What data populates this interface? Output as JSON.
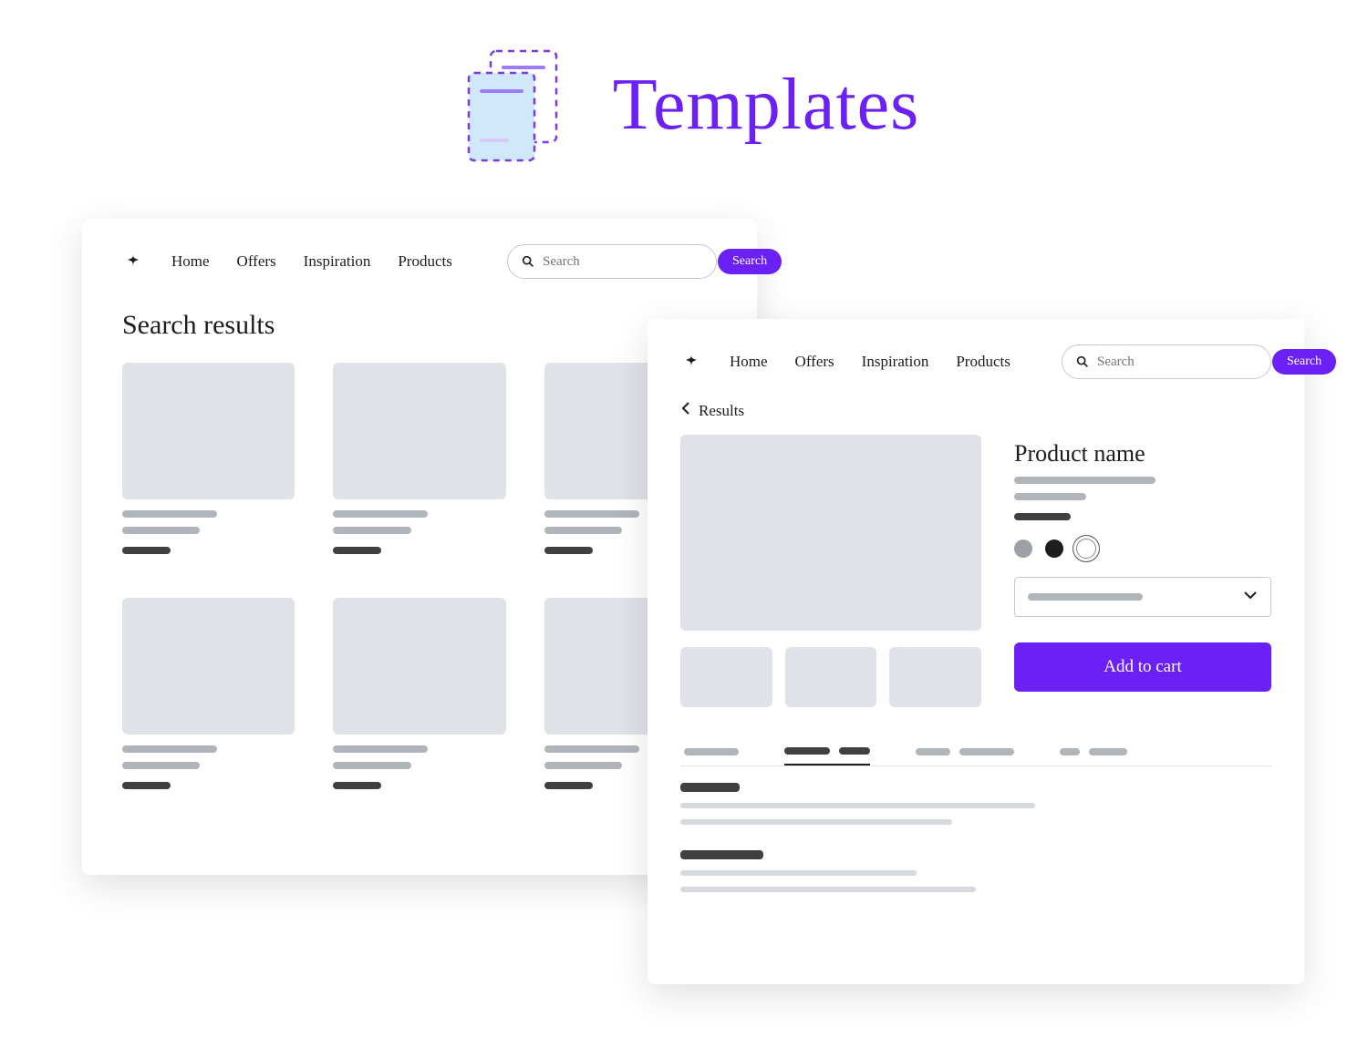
{
  "hero": {
    "title": "Templates"
  },
  "nav": {
    "links": [
      "Home",
      "Offers",
      "Inspiration",
      "Products"
    ],
    "search_placeholder": "Search",
    "search_button": "Search"
  },
  "panel_a": {
    "title": "Search results",
    "card_count": 6
  },
  "panel_b": {
    "back_label": "Results",
    "product_name": "Product name",
    "add_to_cart": "Add to cart",
    "thumb_count": 3,
    "swatches": [
      "grey",
      "black",
      "white"
    ]
  }
}
